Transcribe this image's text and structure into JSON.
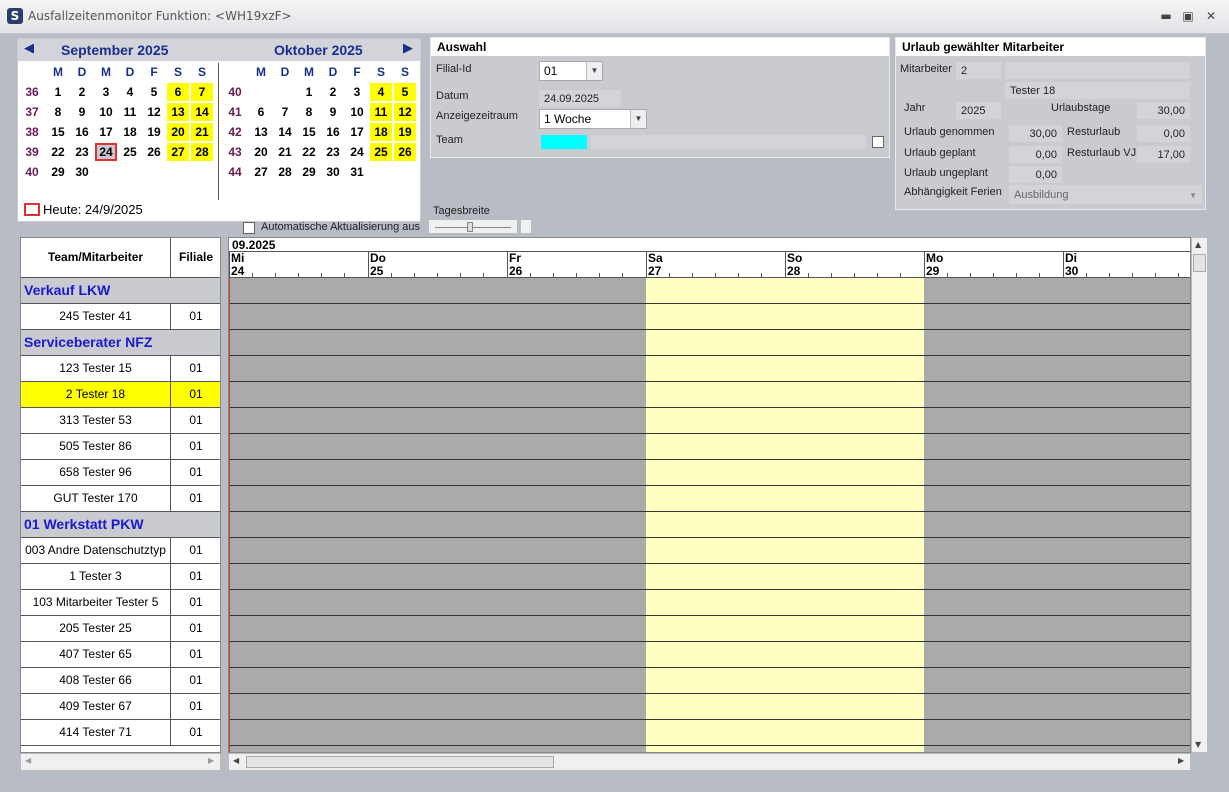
{
  "window": {
    "title": "Ausfallzeitenmonitor Funktion: <WH19xzF>",
    "icon_glyph": "S"
  },
  "calendar": {
    "months": [
      {
        "name": "September 2025",
        "weeks": [
          {
            "wk": "36",
            "days": [
              "1",
              "2",
              "3",
              "4",
              "5",
              "6",
              "7"
            ]
          },
          {
            "wk": "37",
            "days": [
              "8",
              "9",
              "10",
              "11",
              "12",
              "13",
              "14"
            ]
          },
          {
            "wk": "38",
            "days": [
              "15",
              "16",
              "17",
              "18",
              "19",
              "20",
              "21"
            ]
          },
          {
            "wk": "39",
            "days": [
              "22",
              "23",
              "24",
              "25",
              "26",
              "27",
              "28"
            ]
          },
          {
            "wk": "40",
            "days": [
              "29",
              "30",
              "",
              "",
              "",
              "",
              ""
            ]
          }
        ]
      },
      {
        "name": "Oktober 2025",
        "weeks": [
          {
            "wk": "40",
            "days": [
              "",
              "",
              "1",
              "2",
              "3",
              "4",
              "5"
            ]
          },
          {
            "wk": "41",
            "days": [
              "6",
              "7",
              "8",
              "9",
              "10",
              "11",
              "12"
            ]
          },
          {
            "wk": "42",
            "days": [
              "13",
              "14",
              "15",
              "16",
              "17",
              "18",
              "19"
            ]
          },
          {
            "wk": "43",
            "days": [
              "20",
              "21",
              "22",
              "23",
              "24",
              "25",
              "26"
            ]
          },
          {
            "wk": "44",
            "days": [
              "27",
              "28",
              "29",
              "30",
              "31",
              "",
              ""
            ]
          }
        ]
      }
    ],
    "day_names": [
      "M",
      "D",
      "M",
      "D",
      "F",
      "S",
      "S"
    ],
    "selected_day": "24",
    "today_label": "Heute: 24/9/2025",
    "auto_update_label": "Automatische Aktualisierung aus",
    "tagesbreite_label": "Tagesbreite"
  },
  "auswahl": {
    "title": "Auswahl",
    "filial_label": "Filial-Id",
    "filial_value": "01",
    "datum_label": "Datum",
    "datum_value": "24.09.2025",
    "zeitraum_label": "Anzeigezeitraum",
    "zeitraum_value": "1 Woche",
    "team_label": "Team",
    "team_color": "#00ffff"
  },
  "urlaub": {
    "title": "Urlaub gewählter Mitarbeiter",
    "mitarbeiter_label": "Mitarbeiter",
    "mitarbeiter_id": "2",
    "mitarbeiter_name": "Tester 18",
    "jahr_label": "Jahr",
    "jahr_value": "2025",
    "urlaubstage_label": "Urlaubstage",
    "urlaubstage_value": "30,00",
    "genommen_label": "Urlaub genommen",
    "genommen_value": "30,00",
    "resturlaub_label": "Resturlaub",
    "resturlaub_value": "0,00",
    "geplant_label": "Urlaub geplant",
    "geplant_value": "0,00",
    "rest_vj_label": "Resturlaub VJ",
    "rest_vj_value": "17,00",
    "ungeplant_label": "Urlaub ungeplant",
    "ungeplant_value": "0,00",
    "ferien_label": "Abhängigkeit Ferien",
    "ferien_value": "Ausbildung"
  },
  "list": {
    "col_team": "Team/Mitarbeiter",
    "col_filiale": "Filiale",
    "rows": [
      {
        "type": "group",
        "label": "Verkauf LKW"
      },
      {
        "type": "emp",
        "label": "245  Tester 41",
        "filiale": "01"
      },
      {
        "type": "group",
        "label": "Serviceberater NFZ"
      },
      {
        "type": "emp",
        "label": "123  Tester 15",
        "filiale": "01"
      },
      {
        "type": "emp",
        "label": "2  Tester 18",
        "filiale": "01",
        "selected": true
      },
      {
        "type": "emp",
        "label": "313  Tester 53",
        "filiale": "01"
      },
      {
        "type": "emp",
        "label": "505  Tester 86",
        "filiale": "01"
      },
      {
        "type": "emp",
        "label": "658  Tester 96",
        "filiale": "01"
      },
      {
        "type": "emp",
        "label": "GUT  Tester 170",
        "filiale": "01"
      },
      {
        "type": "group",
        "label": "01 Werkstatt PKW"
      },
      {
        "type": "emp",
        "label": "003 Andre Datenschutztyp",
        "filiale": "01"
      },
      {
        "type": "emp",
        "label": "1  Tester 3",
        "filiale": "01"
      },
      {
        "type": "emp",
        "label": "103 Mitarbeiter Tester 5",
        "filiale": "01"
      },
      {
        "type": "emp",
        "label": "205  Tester 25",
        "filiale": "01"
      },
      {
        "type": "emp",
        "label": "407  Tester 65",
        "filiale": "01"
      },
      {
        "type": "emp",
        "label": "408  Tester 66",
        "filiale": "01"
      },
      {
        "type": "emp",
        "label": "409  Tester 67",
        "filiale": "01"
      },
      {
        "type": "emp",
        "label": "414  Tester 71",
        "filiale": "01"
      }
    ]
  },
  "timeline": {
    "month_label": "09.2025",
    "days": [
      {
        "name": "Mi",
        "num": "24",
        "weekend": false
      },
      {
        "name": "Do",
        "num": "25",
        "weekend": false
      },
      {
        "name": "Fr",
        "num": "26",
        "weekend": false
      },
      {
        "name": "Sa",
        "num": "27",
        "weekend": true
      },
      {
        "name": "So",
        "num": "28",
        "weekend": true
      },
      {
        "name": "Mo",
        "num": "29",
        "weekend": false
      },
      {
        "name": "Di",
        "num": "30",
        "weekend": false
      }
    ]
  },
  "colors": {
    "selected_row": "#ffff00",
    "weekend": "#ffffc2",
    "group_text": "#1a1acc",
    "header_blue": "#1a2f8c"
  }
}
